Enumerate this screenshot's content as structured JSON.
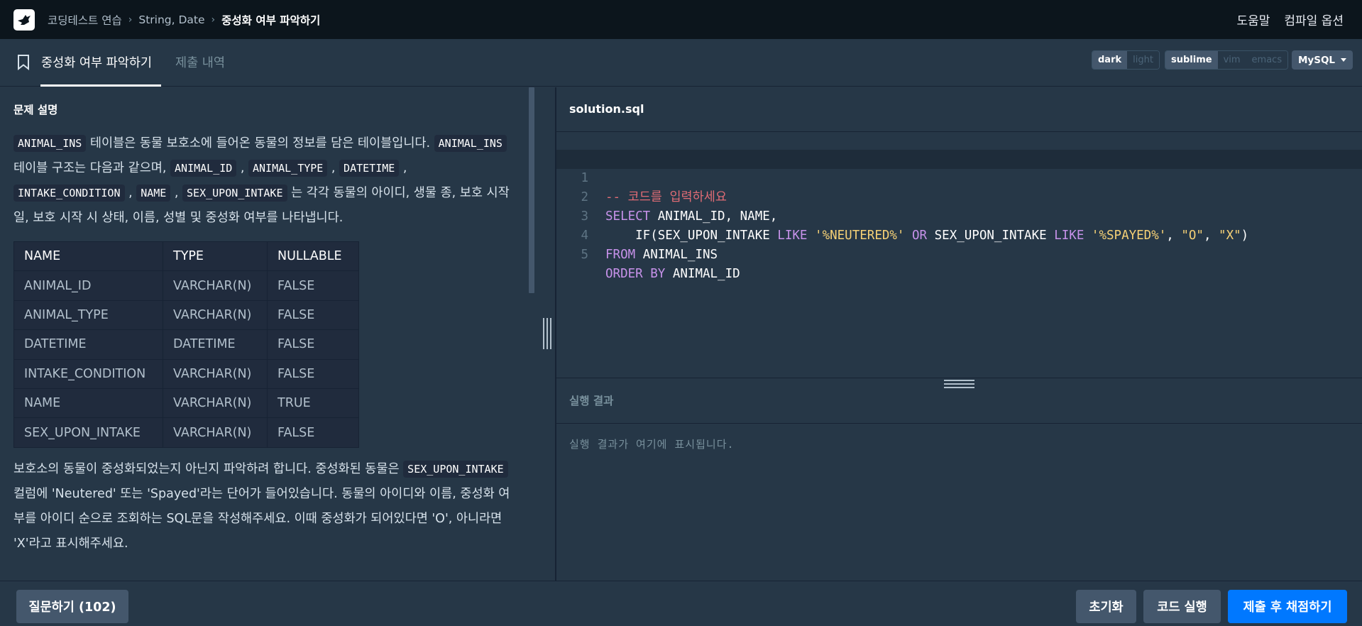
{
  "nav": {
    "breadcrumbs": [
      "코딩테스트 연습",
      "String, Date",
      "중성화 여부 파악하기"
    ],
    "help": "도움말",
    "compile_options": "컴파일 옵션"
  },
  "tabs": {
    "active": "중성화 여부 파악하기",
    "inactive": "제출 내역"
  },
  "theme_toggle": [
    "dark",
    "light"
  ],
  "keymap_toggle": [
    "sublime",
    "vim",
    "emacs"
  ],
  "language": "MySQL",
  "problem": {
    "section_title": "문제 설명",
    "p1": {
      "c1": "ANIMAL_INS",
      "t1": " 테이블은 동물 보호소에 들어온 동물의 정보를 담은 테이블입니다. ",
      "c2": "ANIMAL_INS",
      "t2": " 테이블 구조는 다음과 같으며, ",
      "c3": "ANIMAL_ID",
      "t3": " , ",
      "c4": "ANIMAL_TYPE",
      "t4": " , ",
      "c5": "DATETIME",
      "t5": " , ",
      "c6": "INTAKE_CONDITION",
      "t6": " , ",
      "c7": "NAME",
      "t7": " , ",
      "c8": "SEX_UPON_INTAKE",
      "t8": " 는 각각 동물의 아이디, 생물 종, 보호 시작일, 보호 시작 시 상태, 이름, 성별 및 중성화 여부를 나타냅니다."
    },
    "table": {
      "headers": [
        "NAME",
        "TYPE",
        "NULLABLE"
      ],
      "rows": [
        [
          "ANIMAL_ID",
          "VARCHAR(N)",
          "FALSE"
        ],
        [
          "ANIMAL_TYPE",
          "VARCHAR(N)",
          "FALSE"
        ],
        [
          "DATETIME",
          "DATETIME",
          "FALSE"
        ],
        [
          "INTAKE_CONDITION",
          "VARCHAR(N)",
          "FALSE"
        ],
        [
          "NAME",
          "VARCHAR(N)",
          "TRUE"
        ],
        [
          "SEX_UPON_INTAKE",
          "VARCHAR(N)",
          "FALSE"
        ]
      ]
    },
    "p2": {
      "t1": "보호소의 동물이 중성화되었는지 아닌지 파악하려 합니다. 중성화된 동물은 ",
      "c1": "SEX_UPON_INTAKE",
      "t2": " 컬럼에 'Neutered' 또는 'Spayed'라는 단어가 들어있습니다. 동물의 아이디와 이름, 중성화 여부를 아이디 순으로 조회하는 SQL문을 작성해주세요. 이때 중성화가 되어있다면 'O', 아니라면 'X'라고 표시해주세요."
    }
  },
  "editor": {
    "filename": "solution.sql",
    "line_numbers": [
      "1",
      "2",
      "3",
      "4",
      "5"
    ],
    "l1": "-- 코드를 입력하세요",
    "l2_kw": "SELECT",
    "l2_rest": " ANIMAL_ID, NAME,",
    "l3_a": "    IF(SEX_UPON_INTAKE ",
    "l3_like1": "LIKE",
    "l3_s1": "'%NEUTERED%'",
    "l3_or": "OR",
    "l3_b": " SEX_UPON_INTAKE ",
    "l3_like2": "LIKE",
    "l3_s2": "'%SPAYED%'",
    "l3_c": ", ",
    "l3_s3": "\"O\"",
    "l3_d": ", ",
    "l3_s4": "\"X\"",
    "l3_e": ")",
    "l4_kw": "FROM",
    "l4_rest": " ANIMAL_INS",
    "l5_kw": "ORDER BY",
    "l5_rest": " ANIMAL_ID"
  },
  "result": {
    "label": "실행 결과",
    "placeholder": "실행 결과가 여기에 표시됩니다."
  },
  "buttons": {
    "question": "질문하기 (102)",
    "reset": "초기화",
    "run": "코드 실행",
    "submit": "제출 후 채점하기"
  },
  "colors": {
    "primary": "#0078ff",
    "background": "#263747",
    "nav_bg": "#0c151c"
  }
}
